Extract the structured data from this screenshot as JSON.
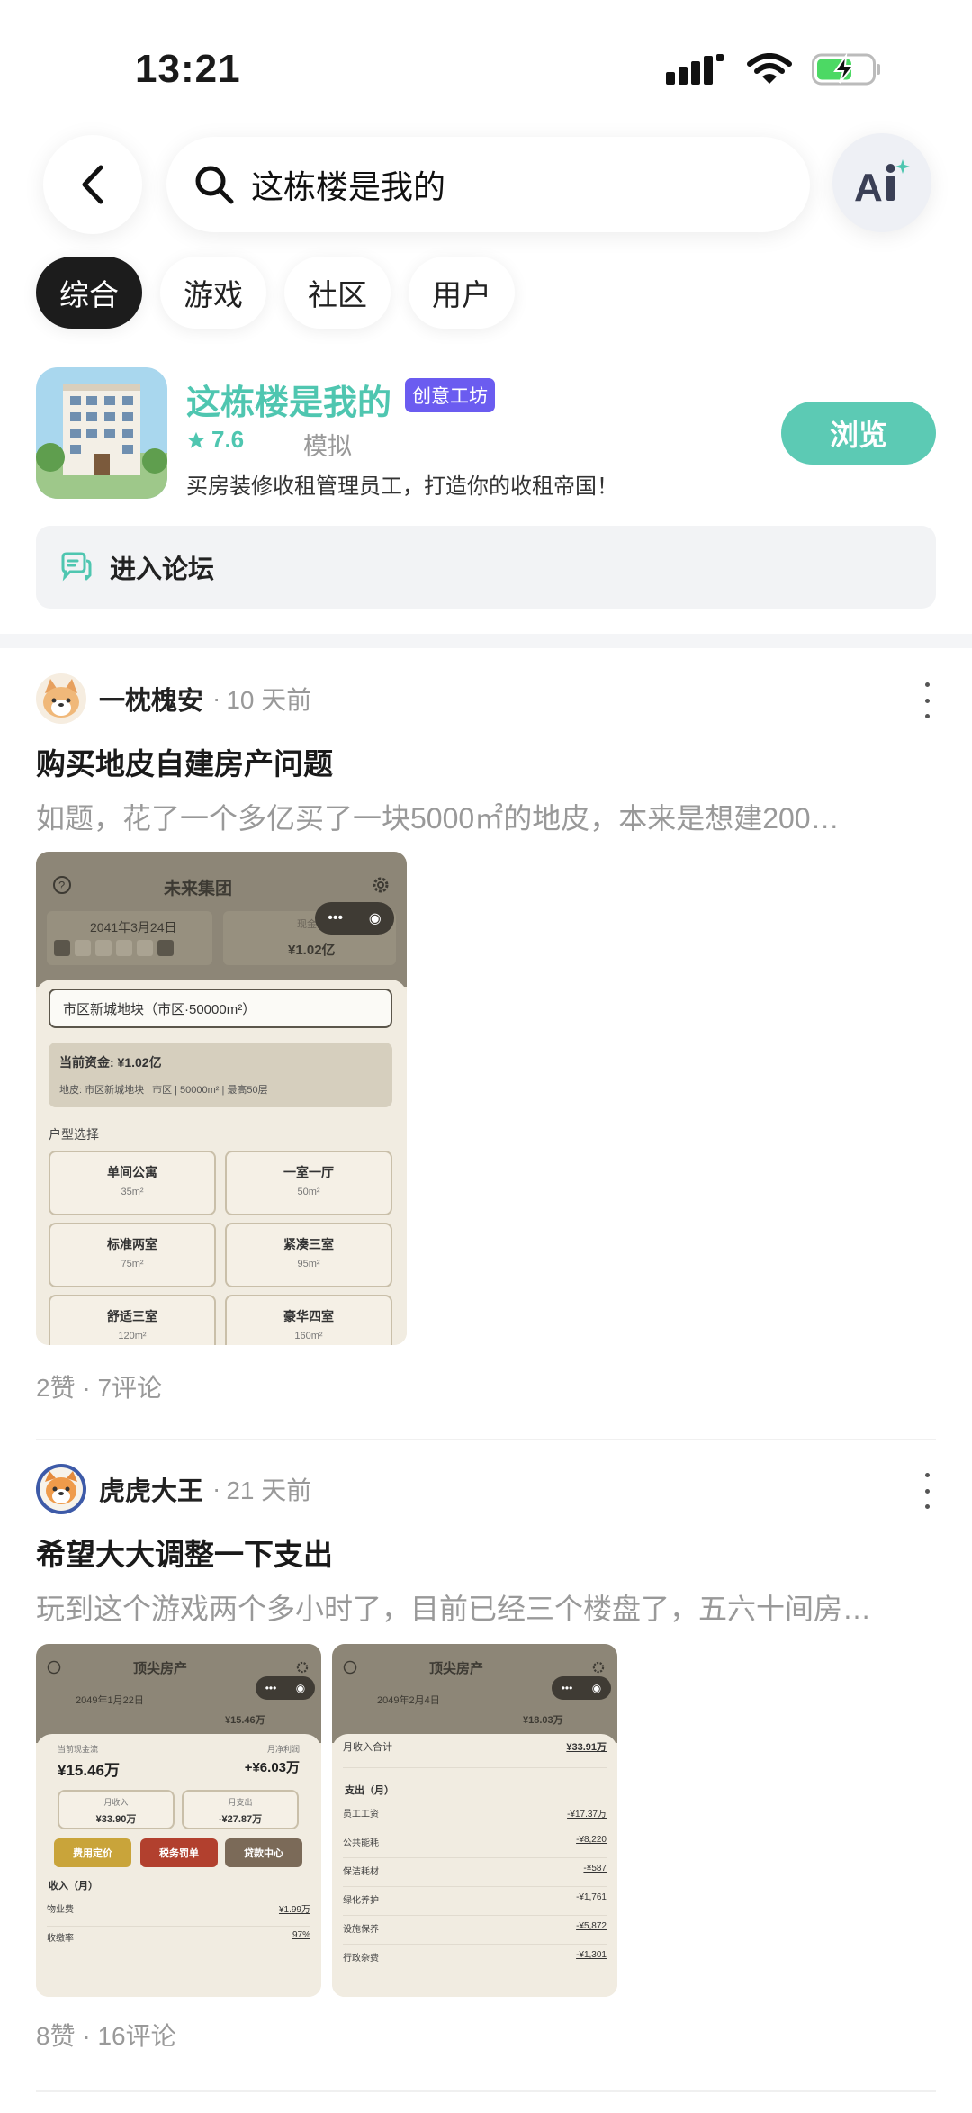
{
  "status_bar": {
    "time": "13:21"
  },
  "search": {
    "query": "这栋楼是我的",
    "ai_label": "AI"
  },
  "tabs": [
    {
      "label": "综合",
      "active": true
    },
    {
      "label": "游戏",
      "active": false
    },
    {
      "label": "社区",
      "active": false
    },
    {
      "label": "用户",
      "active": false
    }
  ],
  "game": {
    "title": "这栋楼是我的",
    "badge": "创意工坊",
    "rating": "7.6",
    "genre": "模拟",
    "description": "买房装修收租管理员工，打造你的收租帝国！",
    "browse_label": "浏览"
  },
  "forum": {
    "label": "进入论坛"
  },
  "posts": [
    {
      "author": "一枕槐安",
      "time_ago": "10 天前",
      "title": "购买地皮自建房产问题",
      "excerpt": "如题，花了一个多亿买了一块5000㎡的地皮，本来是想建200…",
      "stats": "2赞 · 7评论",
      "shot": {
        "company": "未来集团",
        "date": "2041年3月24日",
        "funds_label": "现金流",
        "funds": "¥1.02亿",
        "select_value": "市区新城地块（市区·50000m²）",
        "current_funds": "当前资金: ¥1.02亿",
        "plot_info": "地皮: 市区新城地块 | 市区 | 50000m² | 最高50层",
        "section": "户型选择",
        "options": [
          {
            "name": "单间公寓",
            "area": "35m²"
          },
          {
            "name": "一室一厅",
            "area": "50m²"
          },
          {
            "name": "标准两室",
            "area": "75m²"
          },
          {
            "name": "紧凑三室",
            "area": "95m²"
          },
          {
            "name": "舒适三室",
            "area": "120m²"
          },
          {
            "name": "豪华四室",
            "area": "160m²"
          }
        ]
      }
    },
    {
      "author": "虎虎大王",
      "time_ago": "21 天前",
      "title": "希望大大调整一下支出",
      "excerpt": "玩到这个游戏两个多小时了，目前已经三个楼盘了，五六十间房…",
      "stats": "8赞 · 16评论",
      "shot_a": {
        "company": "顶尖房产",
        "date": "2049年1月22日",
        "funds": "¥15.46万",
        "cash_label": "当前现金流",
        "cash": "¥15.46万",
        "profit_label": "月净利润",
        "profit": "+¥6.03万",
        "income_label": "月收入",
        "income": "¥33.90万",
        "expense_label": "月支出",
        "expense": "-¥27.87万",
        "btn1": "费用定价",
        "btn2": "税务罚单",
        "btn3": "贷款中心",
        "section": "收入（月）",
        "rows": [
          {
            "k": "物业费",
            "v": "¥1.99万"
          },
          {
            "k": "收缴率",
            "v": "97%"
          }
        ]
      },
      "shot_b": {
        "company": "顶尖房产",
        "date": "2049年2月4日",
        "funds": "¥18.03万",
        "total_label": "月收入合计",
        "total": "¥33.91万",
        "section": "支出（月）",
        "rows": [
          {
            "k": "员工工资",
            "v": "-¥17.37万"
          },
          {
            "k": "公共能耗",
            "v": "-¥8,220"
          },
          {
            "k": "保洁耗材",
            "v": "-¥587"
          },
          {
            "k": "绿化养护",
            "v": "-¥1,761"
          },
          {
            "k": "设施保养",
            "v": "-¥5,872"
          },
          {
            "k": "行政杂费",
            "v": "-¥1,301"
          }
        ]
      }
    }
  ],
  "colors": {
    "accent": "#4fc6b0",
    "button": "#5ccab4",
    "badge": "#6b5cf0",
    "active_tab": "#1c1c1c"
  }
}
